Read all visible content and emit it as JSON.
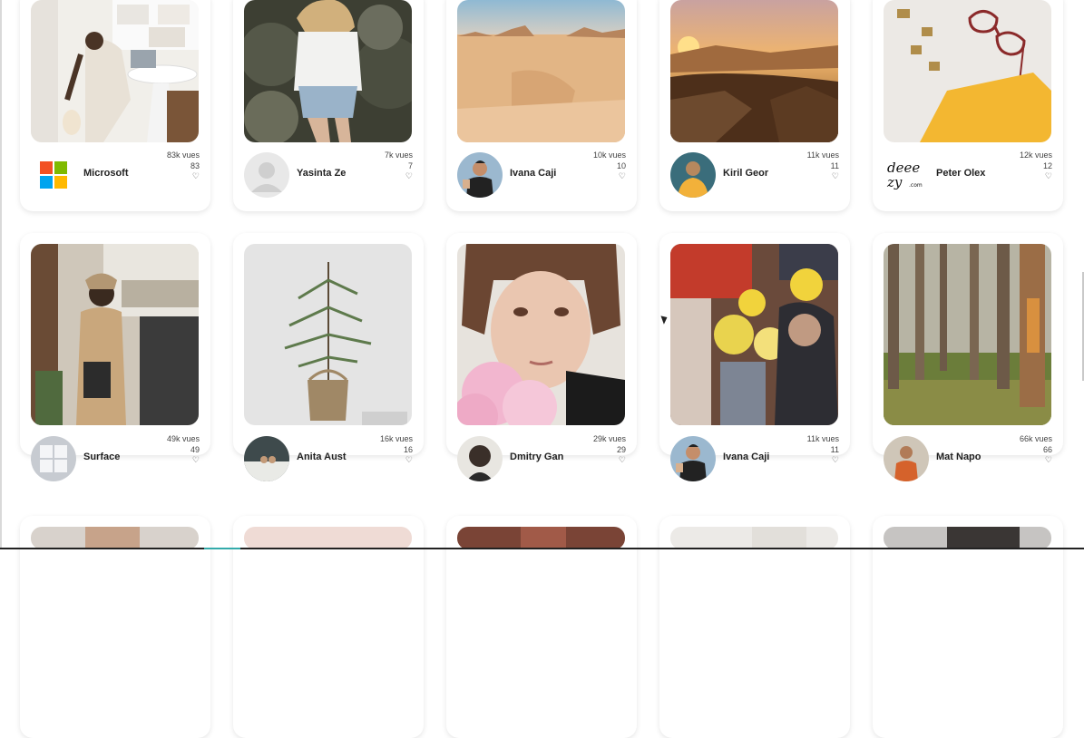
{
  "cards": [
    {
      "name": "Microsoft",
      "views": "83k vues",
      "likes": "83",
      "heart": "♡",
      "avatar": "microsoft-logo",
      "photo": "woman-petting-dog-at-desk"
    },
    {
      "name": "Yasinta Ze",
      "views": "7k vues",
      "likes": "7",
      "heart": "♡",
      "avatar": "placeholder-avatar",
      "photo": "woman-white-shirt-rocks"
    },
    {
      "name": "Ivana Caji",
      "views": "10k vues",
      "likes": "10",
      "heart": "♡",
      "avatar": "person-photo",
      "photo": "desert-landscape"
    },
    {
      "name": "Kiril Geor",
      "views": "11k vues",
      "likes": "11",
      "heart": "♡",
      "avatar": "person-photo",
      "photo": "sunset-mountains"
    },
    {
      "name": "Peter Olex",
      "views": "12k vues",
      "likes": "12",
      "heart": "♡",
      "avatar": "deezy-logo",
      "photo": "glasses-and-notebook"
    },
    {
      "name": "Surface",
      "views": "49k vues",
      "likes": "49",
      "heart": "♡",
      "avatar": "windows-logo",
      "photo": "woman-with-laptop-cafe"
    },
    {
      "name": "Anita Aust",
      "views": "16k vues",
      "likes": "16",
      "heart": "♡",
      "avatar": "person-photo",
      "photo": "small-pine-in-basket"
    },
    {
      "name": "Dmitry Gan",
      "views": "29k vues",
      "likes": "29",
      "heart": "♡",
      "avatar": "person-photo",
      "photo": "woman-with-pink-flowers"
    },
    {
      "name": "Ivana Caji",
      "views": "11k vues",
      "likes": "11",
      "heart": "♡",
      "avatar": "person-photo",
      "photo": "flower-market"
    },
    {
      "name": "Mat Napo",
      "views": "66k vues",
      "likes": "66",
      "heart": "♡",
      "avatar": "person-photo",
      "photo": "forest-trees"
    }
  ],
  "deezy_logo": {
    "line1": "deee",
    "line2": "zy",
    "suffix": ".com"
  }
}
